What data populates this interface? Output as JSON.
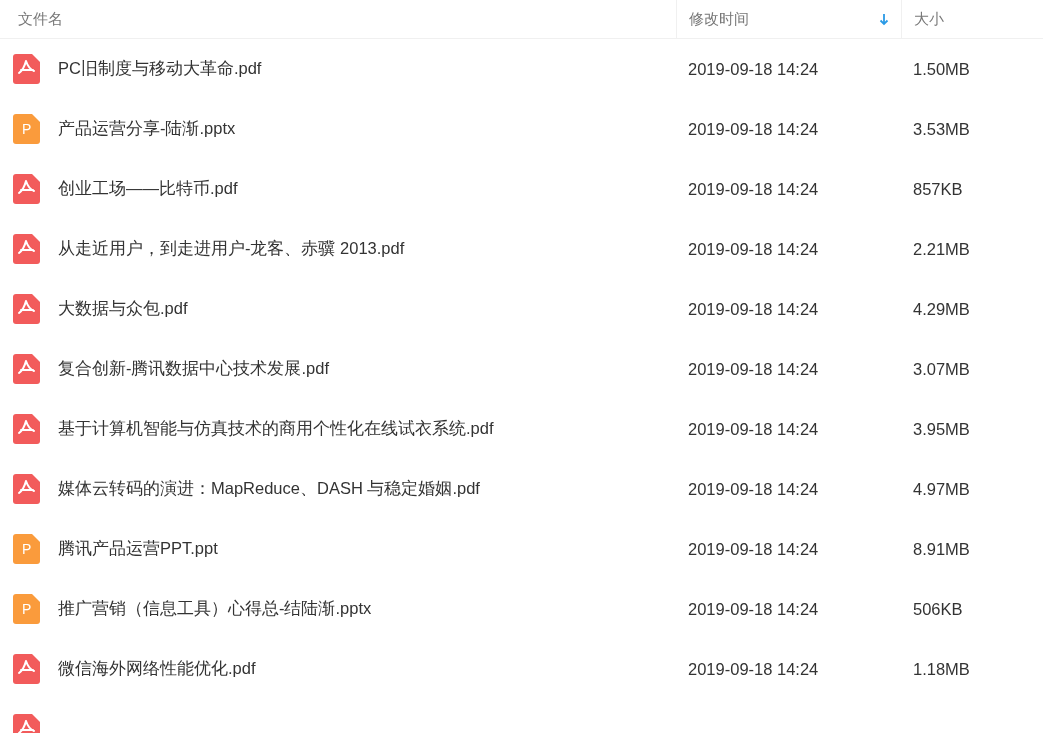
{
  "columns": [
    {
      "label": "文件名",
      "sorted": false
    },
    {
      "label": "修改时间",
      "sorted": true
    },
    {
      "label": "大小",
      "sorted": false
    }
  ],
  "files": [
    {
      "kind": "pdf",
      "name": "PC旧制度与移动大革命.pdf",
      "modified": "2019-09-18 14:24",
      "size": "1.50MB"
    },
    {
      "kind": "ppt",
      "icon_letter": "P",
      "name": "产品运营分享-陆渐.pptx",
      "modified": "2019-09-18 14:24",
      "size": "3.53MB"
    },
    {
      "kind": "pdf",
      "name": "创业工场——比特币.pdf",
      "modified": "2019-09-18 14:24",
      "size": "857KB"
    },
    {
      "kind": "pdf",
      "name": "从走近用户，到走进用户-龙客、赤骥 2013.pdf",
      "modified": "2019-09-18 14:24",
      "size": "2.21MB"
    },
    {
      "kind": "pdf",
      "name": "大数据与众包.pdf",
      "modified": "2019-09-18 14:24",
      "size": "4.29MB"
    },
    {
      "kind": "pdf",
      "name": "复合创新-腾讯数据中心技术发展.pdf",
      "modified": "2019-09-18 14:24",
      "size": "3.07MB"
    },
    {
      "kind": "pdf",
      "name": "基于计算机智能与仿真技术的商用个性化在线试衣系统.pdf",
      "modified": "2019-09-18 14:24",
      "size": "3.95MB"
    },
    {
      "kind": "pdf",
      "name": "媒体云转码的演进：MapReduce、DASH 与稳定婚姻.pdf",
      "modified": "2019-09-18 14:24",
      "size": "4.97MB"
    },
    {
      "kind": "ppt",
      "icon_letter": "P",
      "name": "腾讯产品运营PPT.ppt",
      "modified": "2019-09-18 14:24",
      "size": "8.91MB"
    },
    {
      "kind": "ppt",
      "icon_letter": "P",
      "name": "推广营销（信息工具）心得总-结陆渐.pptx",
      "modified": "2019-09-18 14:24",
      "size": "506KB"
    },
    {
      "kind": "pdf",
      "name": "微信海外网络性能优化.pdf",
      "modified": "2019-09-18 14:24",
      "size": "1.18MB"
    },
    {
      "kind": "pdf"
    }
  ]
}
